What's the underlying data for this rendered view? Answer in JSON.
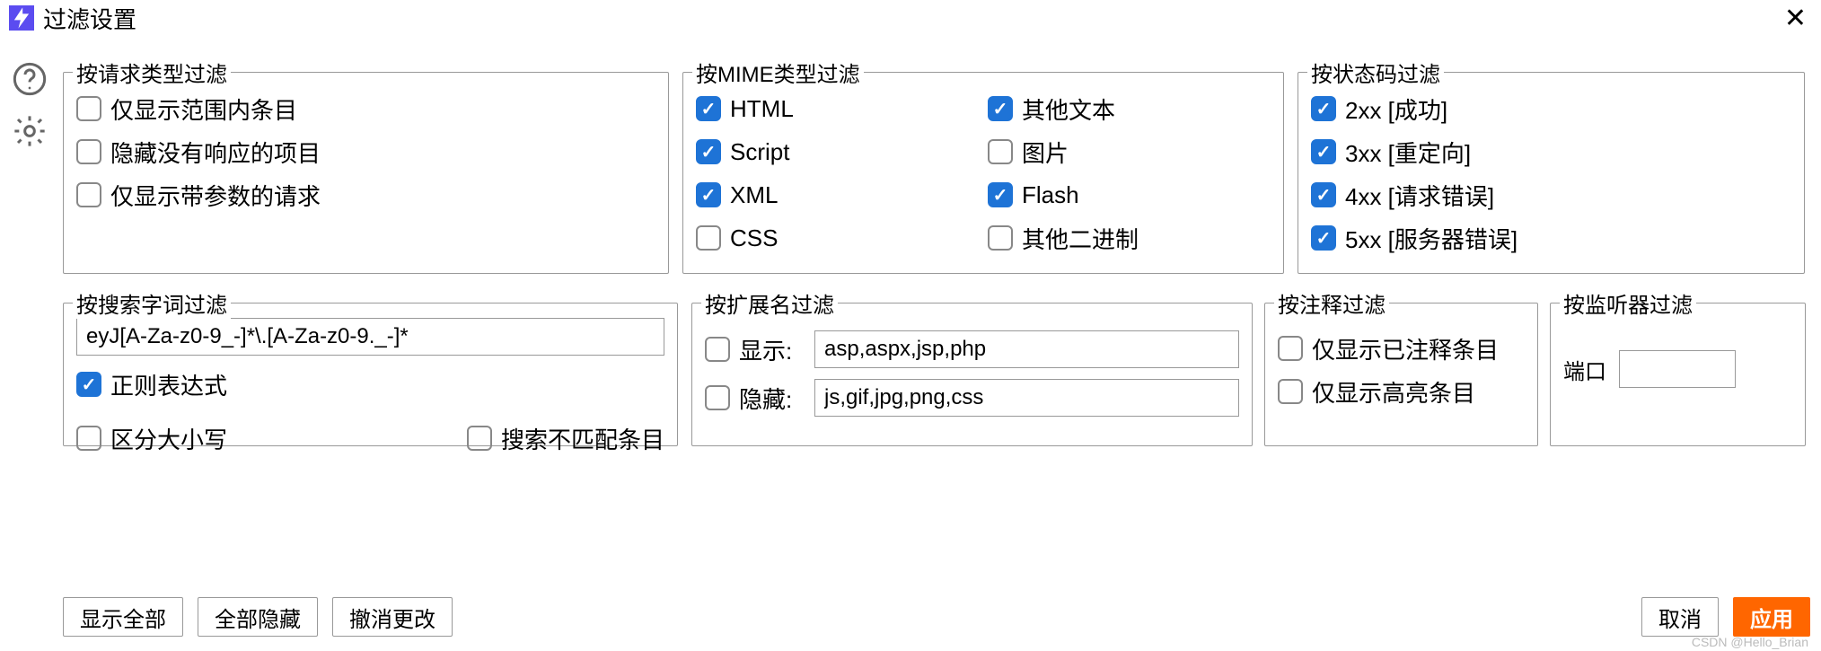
{
  "window": {
    "title": "过滤设置"
  },
  "groups": {
    "reqtype": {
      "title": "按请求类型过滤",
      "items": [
        {
          "label": "仅显示范围内条目",
          "checked": false
        },
        {
          "label": "隐藏没有响应的项目",
          "checked": false
        },
        {
          "label": "仅显示带参数的请求",
          "checked": false
        }
      ]
    },
    "mime": {
      "title": "按MIME类型过滤",
      "items": [
        {
          "label": "HTML",
          "checked": true
        },
        {
          "label": "其他文本",
          "checked": true
        },
        {
          "label": "Script",
          "checked": true
        },
        {
          "label": "图片",
          "checked": false
        },
        {
          "label": "XML",
          "checked": true
        },
        {
          "label": "Flash",
          "checked": true
        },
        {
          "label": "CSS",
          "checked": false
        },
        {
          "label": "其他二进制",
          "checked": false
        }
      ]
    },
    "status": {
      "title": "按状态码过滤",
      "items": [
        {
          "label": "2xx  [成功]",
          "checked": true
        },
        {
          "label": "3xx  [重定向]",
          "checked": true
        },
        {
          "label": "4xx  [请求错误]",
          "checked": true
        },
        {
          "label": "5xx  [服务器错误]",
          "checked": true
        }
      ]
    },
    "search": {
      "title": "按搜索字词过滤",
      "pattern": "eyJ[A-Za-z0-9_-]*\\.[A-Za-z0-9._-]*",
      "regex": {
        "label": "正则表达式",
        "checked": true
      },
      "case": {
        "label": "区分大小写",
        "checked": false
      },
      "negative": {
        "label": "搜索不匹配条目",
        "checked": false
      }
    },
    "ext": {
      "title": "按扩展名过滤",
      "show": {
        "label": "显示:",
        "value": "asp,aspx,jsp,php",
        "checked": false
      },
      "hide": {
        "label": "隐藏:",
        "value": "js,gif,jpg,png,css",
        "checked": false
      }
    },
    "annot": {
      "title": "按注释过滤",
      "commented": {
        "label": "仅显示已注释条目",
        "checked": false
      },
      "highlight": {
        "label": "仅显示高亮条目",
        "checked": false
      }
    },
    "listener": {
      "title": "按监听器过滤",
      "port_label": "端口",
      "port_value": ""
    }
  },
  "buttons": {
    "show_all": "显示全部",
    "hide_all": "全部隐藏",
    "revert": "撤消更改",
    "cancel": "取消",
    "apply": "应用"
  },
  "watermark": "CSDN @Hello_Brian"
}
